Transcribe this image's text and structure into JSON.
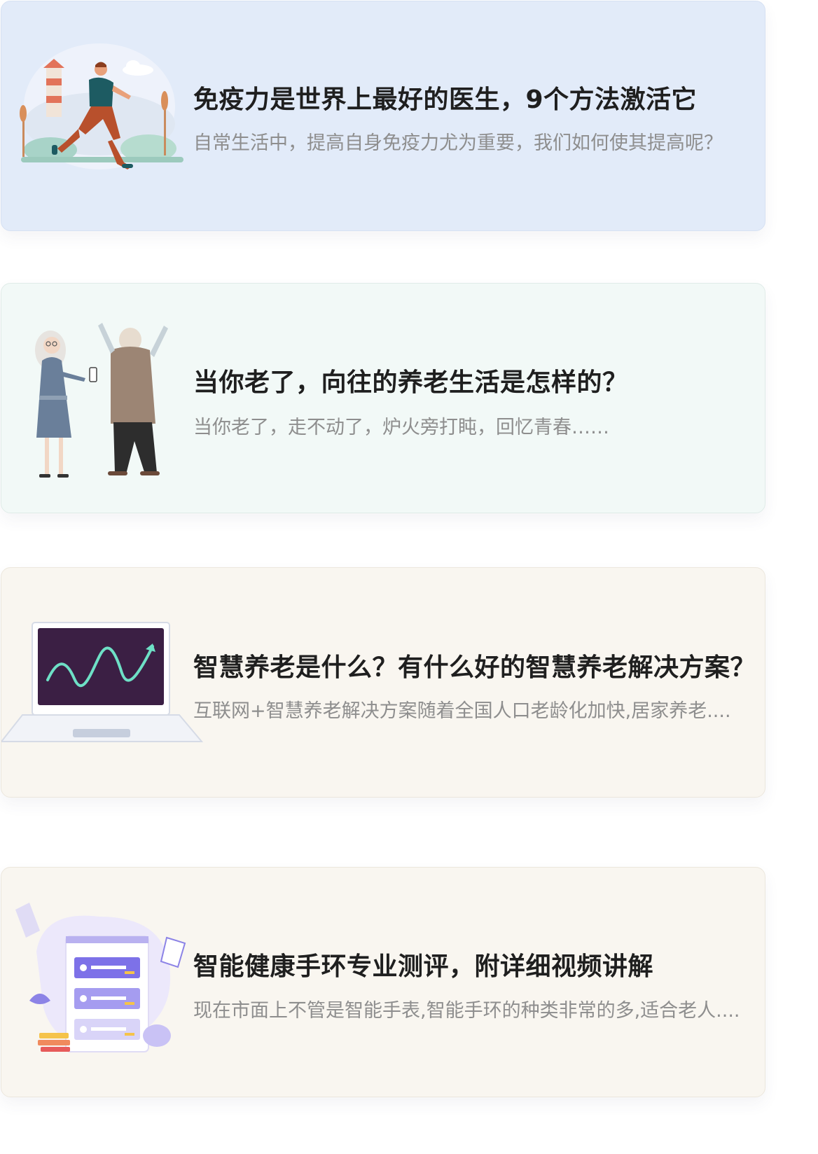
{
  "articles": [
    {
      "title": "免疫力是世界上最好的医生，9个方法激活它",
      "description": "自常生活中，提高自身免疫力尤为重要，我们如何使其提高呢？",
      "illustration": "running-man-illustration",
      "background": "#e2ebf9"
    },
    {
      "title": "当你老了，向往的养老生活是怎样的？",
      "description": "当你老了，走不动了，炉火旁打盹，回忆青春……",
      "illustration": "elderly-couple-illustration",
      "background": "#f2f9f7"
    },
    {
      "title": "智慧养老是什么？有什么好的智慧养老解决方案？",
      "description": "互联网+智慧养老解决方案随着全国人口老龄化加快,居家养老....",
      "illustration": "laptop-chart-illustration",
      "background": "#f9f6f0"
    },
    {
      "title": "智能健康手环专业测评，附详细视频讲解",
      "description": "现在市面上不管是智能手表,智能手环的种类非常的多,适合老人....",
      "illustration": "app-screen-illustration",
      "background": "#f9f6f0"
    }
  ]
}
